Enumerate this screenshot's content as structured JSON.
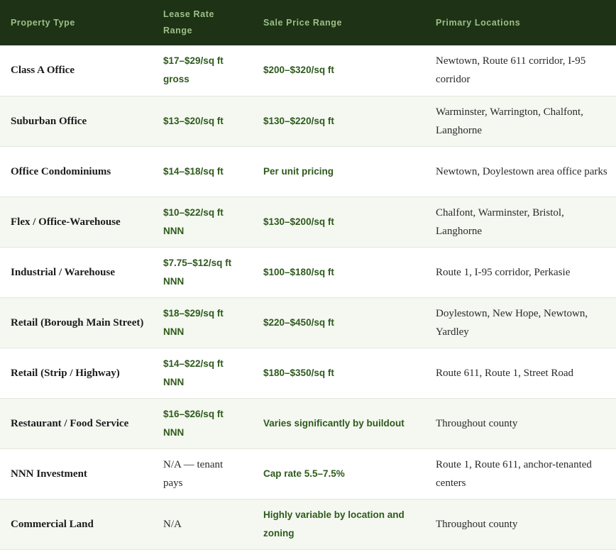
{
  "table": {
    "headers": [
      "Property Type",
      "Lease Rate Range",
      "Sale Price Range",
      "Primary Locations"
    ],
    "rows": [
      {
        "type": "Class A Office",
        "lease": "$17–$29/sq ft gross",
        "sale": "$200–$320/sq ft",
        "locations": "Newtown, Route 611 corridor, I-95 corridor"
      },
      {
        "type": "Suburban Office",
        "lease": "$13–$20/sq ft",
        "sale": "$130–$220/sq ft",
        "locations": "Warminster, Warrington, Chalfont, Langhorne"
      },
      {
        "type": "Office Condominiums",
        "lease": "$14–$18/sq ft",
        "sale": "Per unit pricing",
        "locations": "Newtown, Doylestown area office parks"
      },
      {
        "type": "Flex / Office-Warehouse",
        "lease": "$10–$22/sq ft NNN",
        "sale": "$130–$200/sq ft",
        "locations": "Chalfont, Warminster, Bristol, Langhorne"
      },
      {
        "type": "Industrial / Warehouse",
        "lease": "$7.75–$12/sq ft NNN",
        "sale": "$100–$180/sq ft",
        "locations": "Route 1, I-95 corridor, Perkasie"
      },
      {
        "type": "Retail (Borough Main Street)",
        "lease": "$18–$29/sq ft NNN",
        "sale": "$220–$450/sq ft",
        "locations": "Doylestown, New Hope, Newtown, Yardley"
      },
      {
        "type": "Retail (Strip / Highway)",
        "lease": "$14–$22/sq ft NNN",
        "sale": "$180–$350/sq ft",
        "locations": "Route 611, Route 1, Street Road"
      },
      {
        "type": "Restaurant / Food Service",
        "lease": "$16–$26/sq ft NNN",
        "sale": "Varies significantly by buildout",
        "locations": "Throughout county"
      },
      {
        "type": "NNN Investment",
        "lease": "N/A — tenant pays",
        "sale": "Cap rate 5.5–7.5%",
        "locations": "Route 1, Route 611, anchor-tenanted centers"
      },
      {
        "type": "Commercial Land",
        "lease": "N/A",
        "sale": "Highly variable by location and zoning",
        "locations": "Throughout county"
      }
    ]
  },
  "colors": {
    "header_bg": "#1e3216",
    "header_text": "#9bc086",
    "value_text": "#2e5a1c",
    "alt_row_bg": "#f4f8f0"
  }
}
